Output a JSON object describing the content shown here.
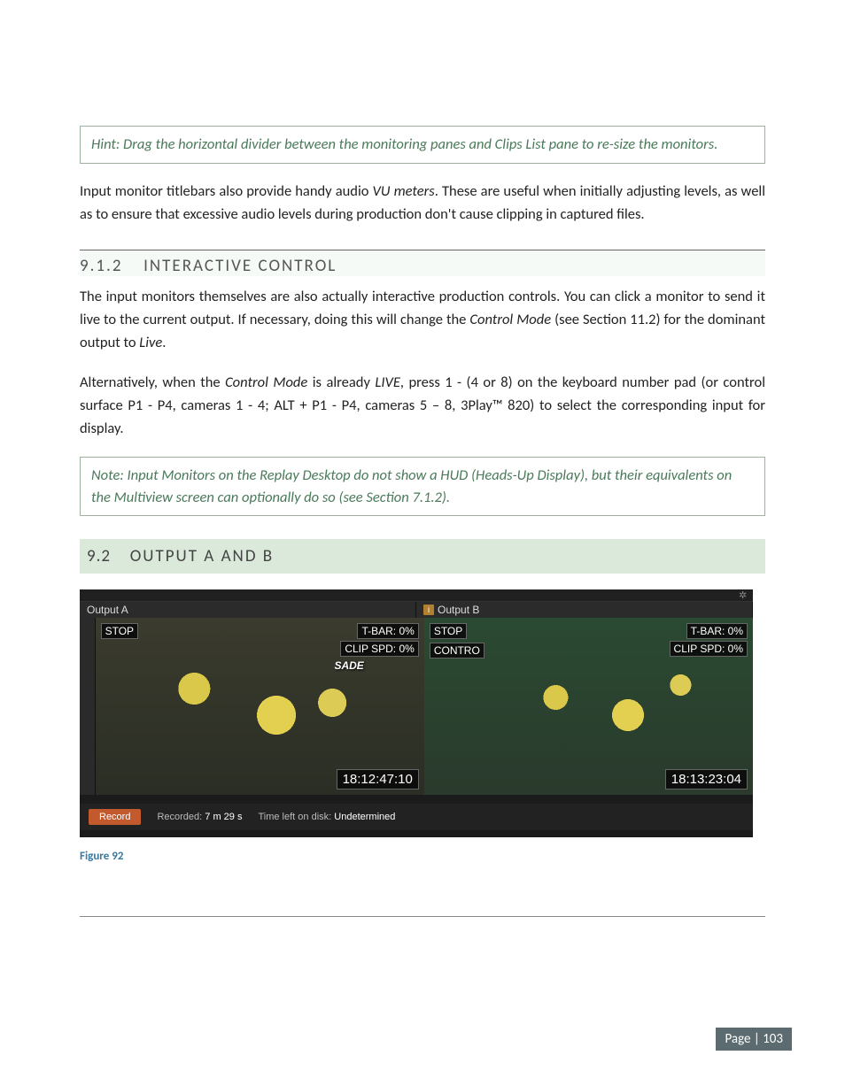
{
  "hint": "Hint: Drag the horizontal divider between the monitoring panes and Clips List pane to re-size the monitors.",
  "para1_a": "Input monitor titlebars also provide handy audio ",
  "para1_i": "VU meters",
  "para1_b": ".  These are useful when initially adjusting levels, as well as to ensure that excessive audio levels during production don't cause clipping in captured files.",
  "sec_912_num": "9.1.2",
  "sec_912_title": "INTERACTIVE CONTROL",
  "para2_a": "The input monitors themselves are also actually interactive production controls.  You can click a monitor to send it live to the current output.  If necessary, doing this will change the ",
  "para2_i1": "Control Mode",
  "para2_b": " (see Section 11.2) for the dominant output to ",
  "para2_i2": "Live",
  "para2_c": ".",
  "para3_a": "Alternatively, when the ",
  "para3_i1": "Control Mode",
  "para3_b": " is already ",
  "para3_i2": "LIVE",
  "para3_c": ", press 1 - (4 or 8) on the keyboard number pad (or control surface P1 - P4, cameras 1 - 4; ALT + P1 - P4, cameras 5 – 8, 3Play™ 820) to select the corresponding input for display.",
  "note": "Note: Input Monitors on the Replay Desktop do not show a HUD (Heads-Up Display), but their equivalents on the Multiview screen can optionally do so (see Section 7.1.2).",
  "sec_92_num": "9.2",
  "sec_92_title": "OUTPUT A AND B",
  "out": {
    "a_label": "Output A",
    "b_label": "Output B",
    "stop": "STOP",
    "contro": "CONTRO",
    "tbar": "T-BAR: 0%",
    "clip": "CLIP SPD: 0%",
    "sade": "SADE",
    "tc_a": "18:12:47:10",
    "tc_b": "18:13:23:04",
    "record_btn": "Record",
    "recorded_lbl": "Recorded: ",
    "recorded_val": "7 m 29 s",
    "timeleft_lbl": "Time left on disk: ",
    "timeleft_val": "Undetermined",
    "info_glyph": "i",
    "gear_glyph": "✲"
  },
  "figure_label": "Figure 92",
  "page_label": "Page | 103"
}
